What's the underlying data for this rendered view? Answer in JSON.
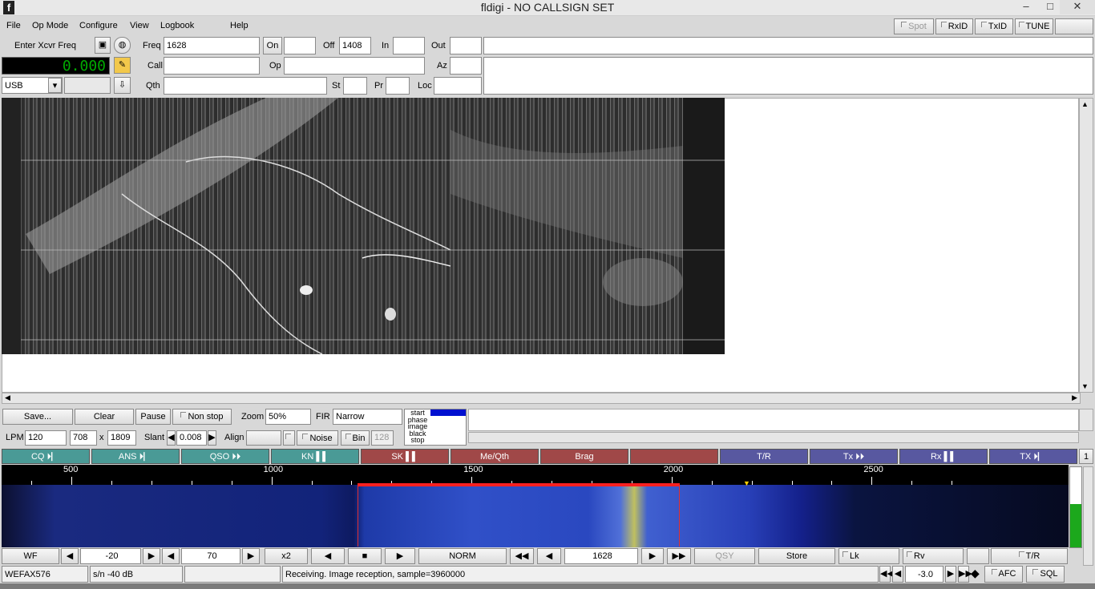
{
  "window": {
    "title": "fldigi - NO CALLSIGN SET",
    "minimize": "–",
    "maximize": "□",
    "close": "✕"
  },
  "menu": [
    "File",
    "Op Mode",
    "Configure",
    "View",
    "Logbook",
    "Help"
  ],
  "toggles": {
    "spot": "Spot",
    "rxid": "RxID",
    "txid": "TxID",
    "tune": "TUNE"
  },
  "log": {
    "enter_xcvr": "Enter Xcvr Freq",
    "freq_display": "0.000",
    "mode": "USB",
    "freq_label": "Freq",
    "freq_value": "1628",
    "on_label": "On",
    "off_label": "Off",
    "off_value": "1408",
    "in_label": "In",
    "out_label": "Out",
    "call_label": "Call",
    "op_label": "Op",
    "az_label": "Az",
    "qth_label": "Qth",
    "st_label": "St",
    "pr_label": "Pr",
    "loc_label": "Loc"
  },
  "fax": {
    "save": "Save...",
    "clear": "Clear",
    "pause": "Pause",
    "nonstop": "Non stop",
    "zoom_label": "Zoom",
    "zoom_value": "50%",
    "fir_label": "FIR",
    "fir_value": "Narrow",
    "states": [
      "start",
      "phase",
      "image",
      "black",
      "stop"
    ],
    "lpm_label": "LPM",
    "lpm_value": "120",
    "width": "708",
    "x": "x",
    "height": "1809",
    "slant_label": "Slant",
    "slant_value": "0.008",
    "align_label": "Align",
    "noise": "Noise",
    "bin": "Bin",
    "bin_value": "128"
  },
  "macros": [
    {
      "label": "CQ ⏵▏",
      "c": "g"
    },
    {
      "label": "ANS ⏵▏",
      "c": "g"
    },
    {
      "label": "QSO ⏵⏵",
      "c": "g"
    },
    {
      "label": "KN ▌▌",
      "c": "g"
    },
    {
      "label": "SK ▌▌",
      "c": "r"
    },
    {
      "label": "Me/Qth",
      "c": "r"
    },
    {
      "label": "Brag",
      "c": "r"
    },
    {
      "label": "",
      "c": "r"
    },
    {
      "label": "T/R",
      "c": "b"
    },
    {
      "label": "Tx ⏵⏵",
      "c": "b"
    },
    {
      "label": "Rx ▌▌",
      "c": "b"
    },
    {
      "label": "TX ⏵▏",
      "c": "b"
    }
  ],
  "macro_page": "1",
  "scale": [
    "500",
    "1000",
    "1500",
    "2000",
    "2500"
  ],
  "wfbar": {
    "wf": "WF",
    "ref": "-20",
    "range": "70",
    "x2": "x2",
    "norm": "NORM",
    "freq": "1628",
    "qsy": "QSY",
    "store": "Store",
    "lk": "Lk",
    "rv": "Rv",
    "tr": "T/R"
  },
  "status": {
    "mode": "WEFAX576",
    "sn": "s/n -40 dB",
    "msg": "Receiving. Image reception, sample=3960000",
    "afc_value": "-3.0",
    "afc": "AFC",
    "sql": "SQL"
  },
  "colors": {
    "freq_display": "#00aa00",
    "tuning_bar": "#ff2020",
    "signal": "#1ca81c"
  }
}
